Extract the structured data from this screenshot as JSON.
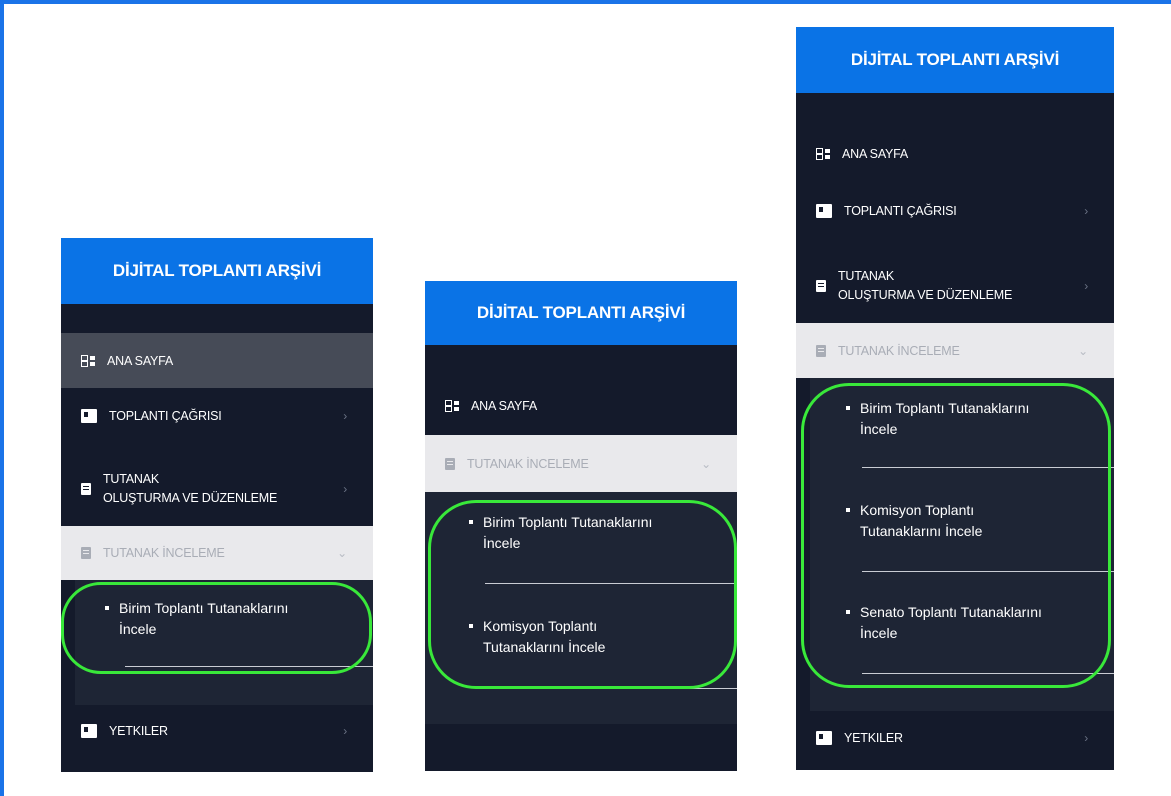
{
  "brand": "DİJİTAL TOPLANTI ARŞİVİ",
  "colors": {
    "brand_blue": "#0a73e6",
    "sidebar_dark": "#141a2b",
    "highlight_green": "#39e83a",
    "frame_blue": "#1a73e8"
  },
  "menu": {
    "home": "ANA SAYFA",
    "call": "TOPLANTI ÇAĞRISI",
    "minutes_create_line1": "TUTANAK",
    "minutes_create_line2": "OLUŞTURMA VE DÜZENLEME",
    "review": "TUTANAK İNCELEME",
    "permissions": "YETKILER"
  },
  "sub": {
    "unit_line1": "Birim Toplantı Tutanaklarını",
    "unit_line2": "İncele",
    "commission_line1": "Komisyon Toplantı",
    "commission_line2": "Tutanaklarını İncele",
    "senate_line1": "Senato Toplantı Tutanaklarını",
    "senate_line2": "İncele"
  },
  "icons": {
    "home": "grid-icon",
    "call": "card-icon",
    "create": "edit-doc-icon",
    "review": "doc-icon",
    "permissions": "card-icon",
    "chevron": "chevron-right-icon"
  }
}
